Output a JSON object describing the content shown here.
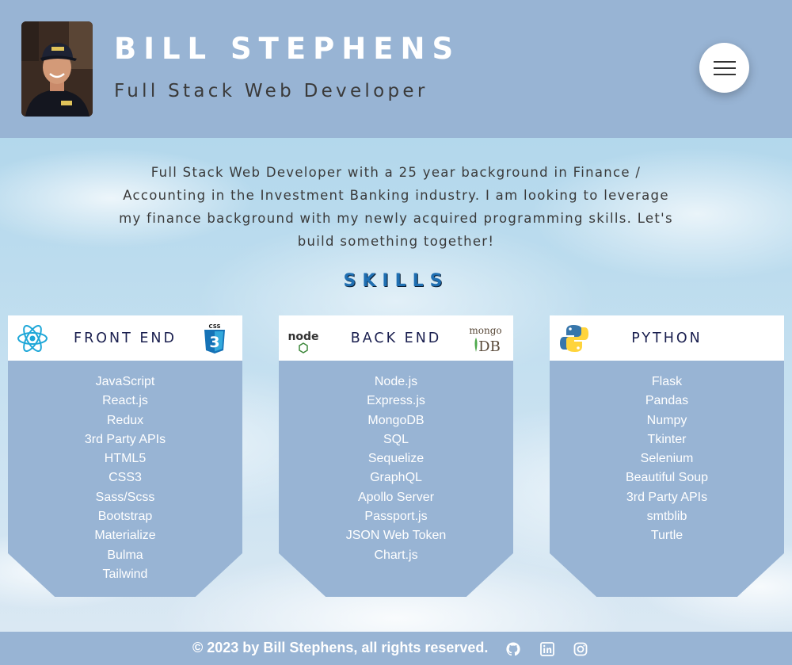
{
  "header": {
    "name": "BILL STEPHENS",
    "title": "Full Stack Web Developer",
    "menu_icon": "hamburger-menu-icon"
  },
  "about": {
    "text": "Full Stack Web Developer with a 25 year background in Finance / Accounting in the Investment Banking industry. I am looking to leverage my finance background with my newly acquired programming skills. Let's build something together!"
  },
  "skills": {
    "heading": "SKILLS",
    "cards": [
      {
        "title": "FRONT END",
        "icon_left": "react-icon",
        "icon_right": "css3-icon",
        "icon_right_text": "CSS",
        "items": [
          "JavaScript",
          "React.js",
          "Redux",
          "3rd Party APIs",
          "HTML5",
          "CSS3",
          "Sass/Scss",
          "Bootstrap",
          "Materialize",
          "Bulma",
          "Tailwind"
        ]
      },
      {
        "title": "BACK END",
        "icon_left": "nodejs-icon",
        "icon_left_text": "node",
        "icon_right": "mongodb-icon",
        "icon_right_text": "mongo",
        "icon_right_text2": "DB",
        "items": [
          "Node.js",
          "Express.js",
          "MongoDB",
          "SQL",
          "Sequelize",
          "GraphQL",
          "Apollo Server",
          "Passport.js",
          "JSON Web Token",
          "Chart.js"
        ]
      },
      {
        "title": "PYTHON",
        "icon_left": "python-icon",
        "items": [
          "Flask",
          "Pandas",
          "Numpy",
          "Tkinter",
          "Selenium",
          "Beautiful Soup",
          "3rd Party APIs",
          "smtblib",
          "Turtle"
        ]
      }
    ]
  },
  "footer": {
    "copyright": "© 2023 by Bill Stephens, all rights reserved.",
    "links": [
      "github-icon",
      "linkedin-icon",
      "instagram-icon"
    ]
  },
  "colors": {
    "header_bg": "#98b4d4",
    "card_bg": "#98b4d4",
    "skills_heading": "#1f6fb2",
    "card_title": "#1a1f4f"
  }
}
